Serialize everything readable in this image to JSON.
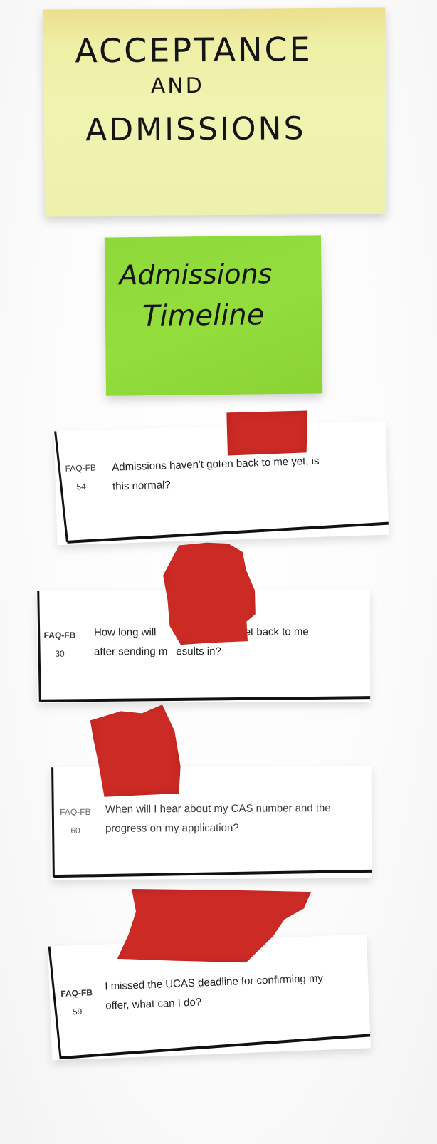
{
  "sticky_notes": {
    "category": {
      "line1": "ACCEPTANCE",
      "line2": "AND",
      "line3": "ADMISSIONS",
      "color": "#eff1ab"
    },
    "topic": {
      "line1": "Admissions",
      "line2": "Timeline",
      "color": "#90da3b"
    }
  },
  "tape_color": "#cc2a25",
  "cards": [
    {
      "code_prefix": "FAQ-FB",
      "code_number": "54",
      "question_line1": "Admissions haven't go",
      "question_line1b": "ten back to me yet, is",
      "question_line2": "this normal?"
    },
    {
      "code_prefix": "FAQ-FB",
      "code_number": "30",
      "question_line1": "How long will",
      "question_line1b": "e Uni to get back to me",
      "question_line2": "after sending m",
      "question_line2b": "esults in?"
    },
    {
      "code_prefix": "FAQ-FB",
      "code_number": "60",
      "question_line1": "When will I hear about my CAS number and the",
      "question_line2": "progress on my application?"
    },
    {
      "code_prefix": "FAQ-FB",
      "code_number": "59",
      "question_line1": "I missed the UCAS deadline for confirming my",
      "question_line2": "offer, what can I do?"
    }
  ]
}
